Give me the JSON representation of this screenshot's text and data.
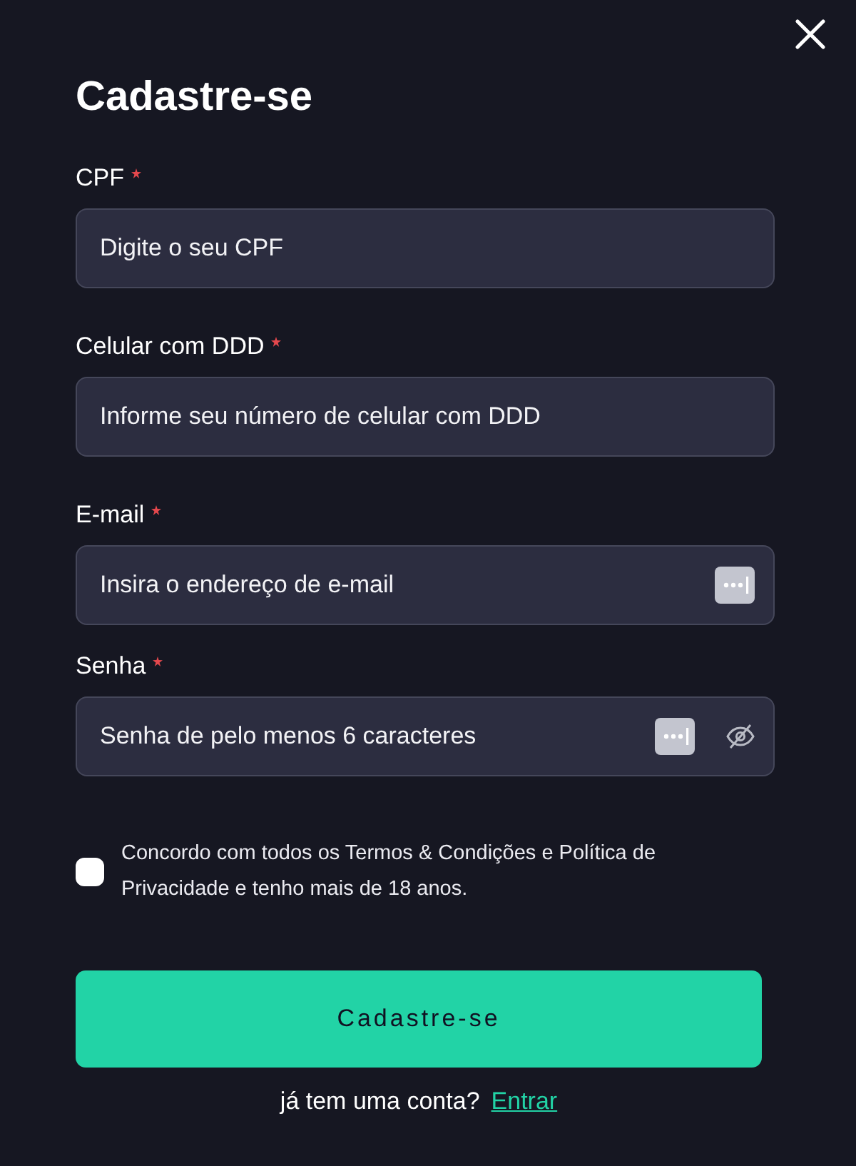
{
  "title": "Cadastre-se",
  "fields": [
    {
      "label": "CPF",
      "required": true,
      "placeholder": "Digite o seu CPF",
      "kind": "text"
    },
    {
      "label": "Celular com DDD",
      "required": true,
      "placeholder": "Informe seu número de celular com DDD",
      "kind": "text"
    },
    {
      "label": "E-mail",
      "required": true,
      "placeholder": "Insira o endereço de e-mail",
      "kind": "email"
    },
    {
      "label": "Senha",
      "required": true,
      "placeholder": "Senha de pelo menos 6 caracteres",
      "kind": "password"
    }
  ],
  "agreement": {
    "text": "Concordo com todos os Termos & Condições e Política de Privacidade e tenho mais de 18 anos.",
    "checked": false
  },
  "submit": "Cadastre-se",
  "login_prompt": "já tem uma conta?",
  "login_link": "Entrar"
}
